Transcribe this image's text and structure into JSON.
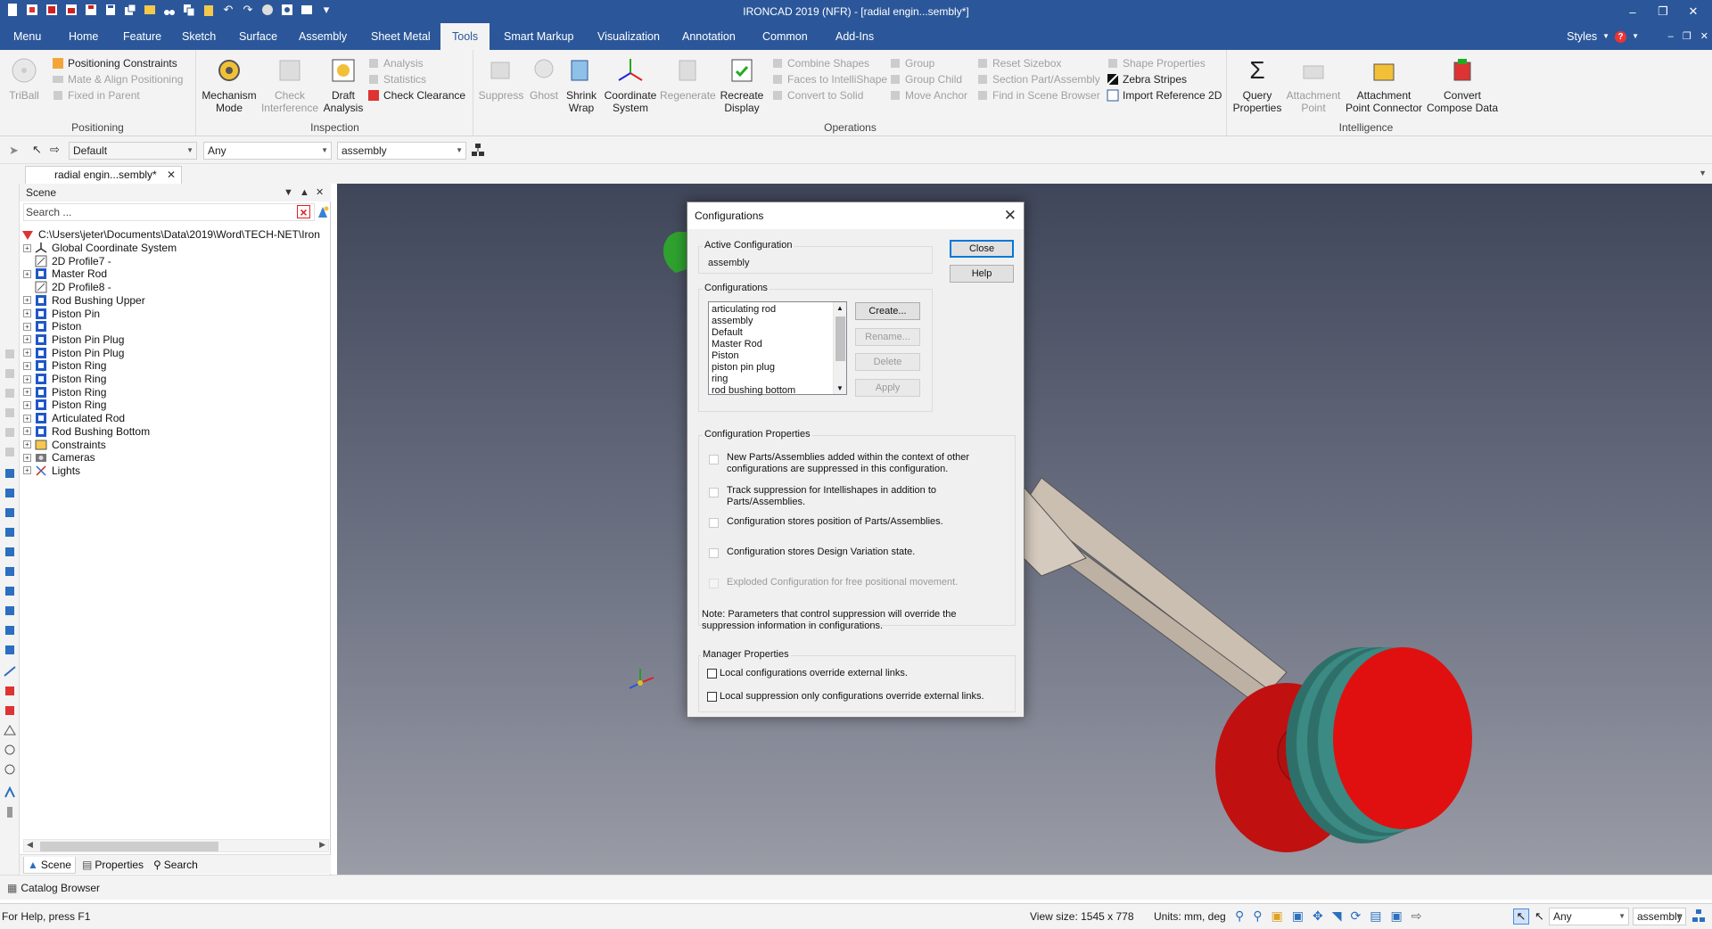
{
  "window": {
    "title": "IRONCAD 2019 (NFR) - [radial engin...sembly*]"
  },
  "menu": {
    "tabs": [
      "Menu",
      "Home",
      "Feature",
      "Sketch",
      "Surface",
      "Assembly",
      "Sheet Metal",
      "Tools",
      "Smart Markup",
      "Visualization",
      "Annotation",
      "Common",
      "Add-Ins"
    ],
    "active": "Tools",
    "styles_label": "Styles"
  },
  "ribbon": {
    "positioning": {
      "label": "Positioning",
      "triball": "TriBall",
      "positioning_constraints": "Positioning Constraints",
      "mate_align": "Mate & Align Positioning",
      "fixed_in_parent": "Fixed in Parent"
    },
    "inspection": {
      "label": "Inspection",
      "mechanism_mode": [
        "Mechanism",
        "Mode"
      ],
      "check_interference": [
        "Check",
        "Interference"
      ],
      "draft_analysis": [
        "Draft",
        "Analysis"
      ],
      "analysis": "Analysis",
      "statistics": "Statistics",
      "check_clearance": "Check Clearance"
    },
    "operations": {
      "label": "Operations",
      "suppress": "Suppress",
      "ghost": "Ghost",
      "shrink_wrap": [
        "Shrink",
        "Wrap"
      ],
      "coordinate_system": [
        "Coordinate",
        "System"
      ],
      "regenerate": "Regenerate",
      "recreate_display": [
        "Recreate",
        "Display"
      ],
      "combine_shapes": "Combine Shapes",
      "faces_to_intellishape": "Faces to IntelliShape",
      "convert_to_solid": "Convert to Solid",
      "group": "Group",
      "group_child": "Group Child",
      "move_anchor": "Move Anchor",
      "reset_sizebox": "Reset Sizebox",
      "section_part": "Section Part/Assembly",
      "find_in_scene": "Find in Scene Browser",
      "shape_properties": "Shape Properties",
      "zebra_stripes": "Zebra Stripes",
      "import_reference": "Import Reference 2D"
    },
    "intelligence": {
      "label": "Intelligence",
      "query_properties": [
        "Query",
        "Properties"
      ],
      "attachment_point": [
        "Attachment",
        "Point"
      ],
      "attachment_connector": [
        "Attachment",
        "Point Connector"
      ],
      "convert_compose": [
        "Convert",
        "Compose Data"
      ]
    }
  },
  "toolbar2": {
    "combo1": "Default",
    "combo2": "Any",
    "combo3": "assembly"
  },
  "doc_tab": {
    "label": "radial engin...sembly*"
  },
  "scene": {
    "header": "Scene",
    "search_placeholder": "Search ...",
    "root_path": "C:\\Users\\jeter\\Documents\\Data\\2019\\Word\\TECH-NET\\Iron",
    "items": [
      {
        "label": "Global Coordinate System",
        "icon": "coordinate-system-icon"
      },
      {
        "label": "2D Profile7 -",
        "icon": "profile-2d-icon"
      },
      {
        "label": "Master Rod",
        "icon": "part-icon"
      },
      {
        "label": "2D Profile8 -",
        "icon": "profile-2d-icon"
      },
      {
        "label": "Rod Bushing Upper",
        "icon": "part-icon"
      },
      {
        "label": "Piston Pin",
        "icon": "part-icon"
      },
      {
        "label": "Piston",
        "icon": "part-icon"
      },
      {
        "label": "Piston Pin Plug",
        "icon": "part-icon"
      },
      {
        "label": "Piston Pin Plug",
        "icon": "part-icon"
      },
      {
        "label": "Piston Ring",
        "icon": "part-icon"
      },
      {
        "label": "Piston Ring",
        "icon": "part-icon"
      },
      {
        "label": "Piston Ring",
        "icon": "part-icon"
      },
      {
        "label": "Piston Ring",
        "icon": "part-icon"
      },
      {
        "label": "Articulated Rod",
        "icon": "part-icon"
      },
      {
        "label": "Rod Bushing Bottom",
        "icon": "part-icon"
      },
      {
        "label": "Constraints",
        "icon": "constraints-icon"
      },
      {
        "label": "Cameras",
        "icon": "camera-icon"
      },
      {
        "label": "Lights",
        "icon": "light-icon"
      }
    ],
    "bottom_tabs": [
      "Scene",
      "Properties",
      "Search"
    ]
  },
  "catalog": {
    "label": "Catalog Browser"
  },
  "dialog": {
    "title": "Configurations",
    "active_config_label": "Active Configuration",
    "active_config_value": "assembly",
    "configs_label": "Configurations",
    "configs": [
      "articulating rod",
      "assembly",
      "Default",
      "Master Rod",
      "Piston",
      "piston pin plug",
      "ring",
      "rod bushing bottom"
    ],
    "buttons": {
      "close": "Close",
      "help": "Help",
      "create": "Create...",
      "rename": "Rename...",
      "delete": "Delete",
      "apply": "Apply"
    },
    "props_label": "Configuration Properties",
    "props": [
      {
        "text": "New Parts/Assemblies added within the context of other configurations are suppressed in this configuration.",
        "checked": false,
        "enabled": true
      },
      {
        "text": "Track suppression for Intellishapes in addition to Parts/Assemblies.",
        "checked": false,
        "enabled": true
      },
      {
        "text": "Configuration stores position of Parts/Assemblies.",
        "checked": false,
        "enabled": true
      },
      {
        "text": "Configuration stores Design Variation state.",
        "checked": false,
        "enabled": true
      },
      {
        "text": "Exploded Configuration for free positional movement.",
        "checked": false,
        "enabled": false
      }
    ],
    "note": "Note: Parameters that control suppression will override the suppression information in configurations.",
    "manager_label": "Manager Properties",
    "manager": [
      {
        "text": "Local configurations override external links.",
        "checked": false
      },
      {
        "text": "Local suppression only configurations override external links.",
        "checked": false
      }
    ]
  },
  "status": {
    "help": "For Help, press F1",
    "view_size": "View size: 1545 x 778",
    "units": "Units: mm, deg",
    "combo_any": "Any",
    "combo_assembly": "assembly"
  },
  "colors": {
    "titlebar": "#2b579a",
    "piston_red": "#e01010",
    "ring_teal": "#2f6f6a",
    "rod_tan": "#cbbfb2",
    "viewport_top": "#3f4659",
    "viewport_bottom": "#9a9ca6"
  }
}
